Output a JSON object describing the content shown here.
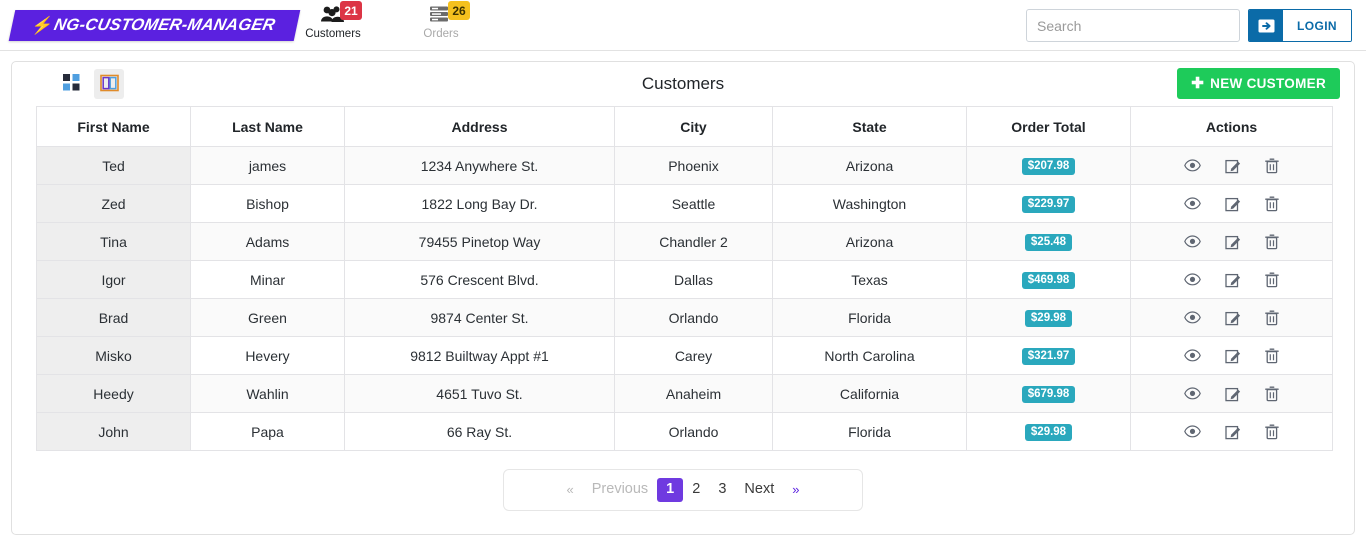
{
  "navbar": {
    "brand": {
      "text": "NG-CUSTOMER-MANAGER",
      "bolt_icon": "lightning-bolt-icon",
      "bg_color": "#5b21e0"
    },
    "items": [
      {
        "label": "Customers",
        "badge": "21",
        "badge_color": "#dc3545",
        "icon": "users-group-icon",
        "active": true
      },
      {
        "label": "Orders",
        "badge": "26",
        "badge_color": "#f5c11e",
        "icon": "server-list-icon",
        "active": false
      }
    ],
    "search": {
      "value": "",
      "placeholder": "Search"
    },
    "login": {
      "label": "LOGIN",
      "icon": "sign-in-icon",
      "color": "#0b6ba8"
    }
  },
  "card": {
    "title": "Customers",
    "view_toggles": [
      {
        "name": "grid-view",
        "icon": "grid-icon",
        "active": false
      },
      {
        "name": "table-view",
        "icon": "table-columns-icon",
        "active": true
      }
    ],
    "new_button": {
      "label": "NEW CUSTOMER",
      "icon": "plus-icon",
      "color": "#1ecb5a"
    }
  },
  "table": {
    "columns": [
      "First Name",
      "Last Name",
      "Address",
      "City",
      "State",
      "Order Total",
      "Actions"
    ],
    "action_icons": [
      "eye-icon",
      "edit-icon",
      "trash-icon"
    ],
    "rows": [
      {
        "first": "Ted",
        "last": "james",
        "address": "1234 Anywhere St.",
        "city": "Phoenix",
        "state": "Arizona",
        "total": "$207.98"
      },
      {
        "first": "Zed",
        "last": "Bishop",
        "address": "1822 Long Bay Dr.",
        "city": "Seattle",
        "state": "Washington",
        "total": "$229.97"
      },
      {
        "first": "Tina",
        "last": "Adams",
        "address": "79455 Pinetop Way",
        "city": "Chandler 2",
        "state": "Arizona",
        "total": "$25.48"
      },
      {
        "first": "Igor",
        "last": "Minar",
        "address": "576 Crescent Blvd.",
        "city": "Dallas",
        "state": "Texas",
        "total": "$469.98"
      },
      {
        "first": "Brad",
        "last": "Green",
        "address": "9874 Center St.",
        "city": "Orlando",
        "state": "Florida",
        "total": "$29.98"
      },
      {
        "first": "Misko",
        "last": "Hevery",
        "address": "9812 Builtway Appt #1",
        "city": "Carey",
        "state": "North Carolina",
        "total": "$321.97"
      },
      {
        "first": "Heedy",
        "last": "Wahlin",
        "address": "4651 Tuvo St.",
        "city": "Anaheim",
        "state": "California",
        "total": "$679.98"
      },
      {
        "first": "John",
        "last": "Papa",
        "address": "66 Ray St.",
        "city": "Orlando",
        "state": "Florida",
        "total": "$29.98"
      }
    ]
  },
  "pagination": {
    "first_chevron": "«",
    "previous_label": "Previous",
    "pages": [
      "1",
      "2",
      "3"
    ],
    "active_page": "1",
    "next_label": "Next",
    "last_chevron": "»",
    "active_color": "#6f3ae0"
  }
}
